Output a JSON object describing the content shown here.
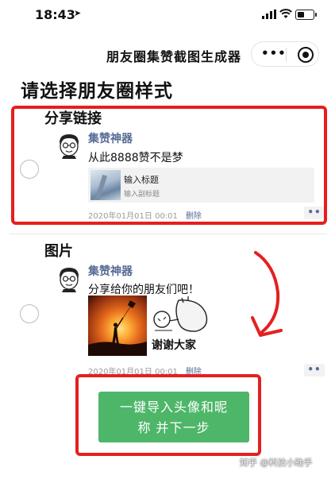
{
  "status_bar": {
    "time": "18:43"
  },
  "nav": {
    "title": "朋友圈集赞截图生成器",
    "more": "•••"
  },
  "heading": "请选择朋友圈样式",
  "styles": [
    {
      "title": "分享链接",
      "nickname": "集赞神器",
      "text": "从此8888赞不是梦",
      "link_title": "输入标题",
      "link_subtitle": "输入副标题",
      "date": "2020年01月01日 00:01",
      "delete": "删除",
      "more": "••"
    },
    {
      "title": "图片",
      "nickname": "集赞神器",
      "text": "分享给你的朋友们吧！",
      "image_caption": "谢谢大家",
      "date": "2020年01月01日 00:01",
      "delete": "删除",
      "more": "••"
    }
  ],
  "action_button": {
    "line1": "一键导入头像和昵",
    "line2": "称 并下一步"
  },
  "watermark": "知乎 @科技小助手",
  "colors": {
    "accent_green": "#4eb669",
    "nickname_blue": "#576b95",
    "annotation_red": "#e51f1f"
  }
}
